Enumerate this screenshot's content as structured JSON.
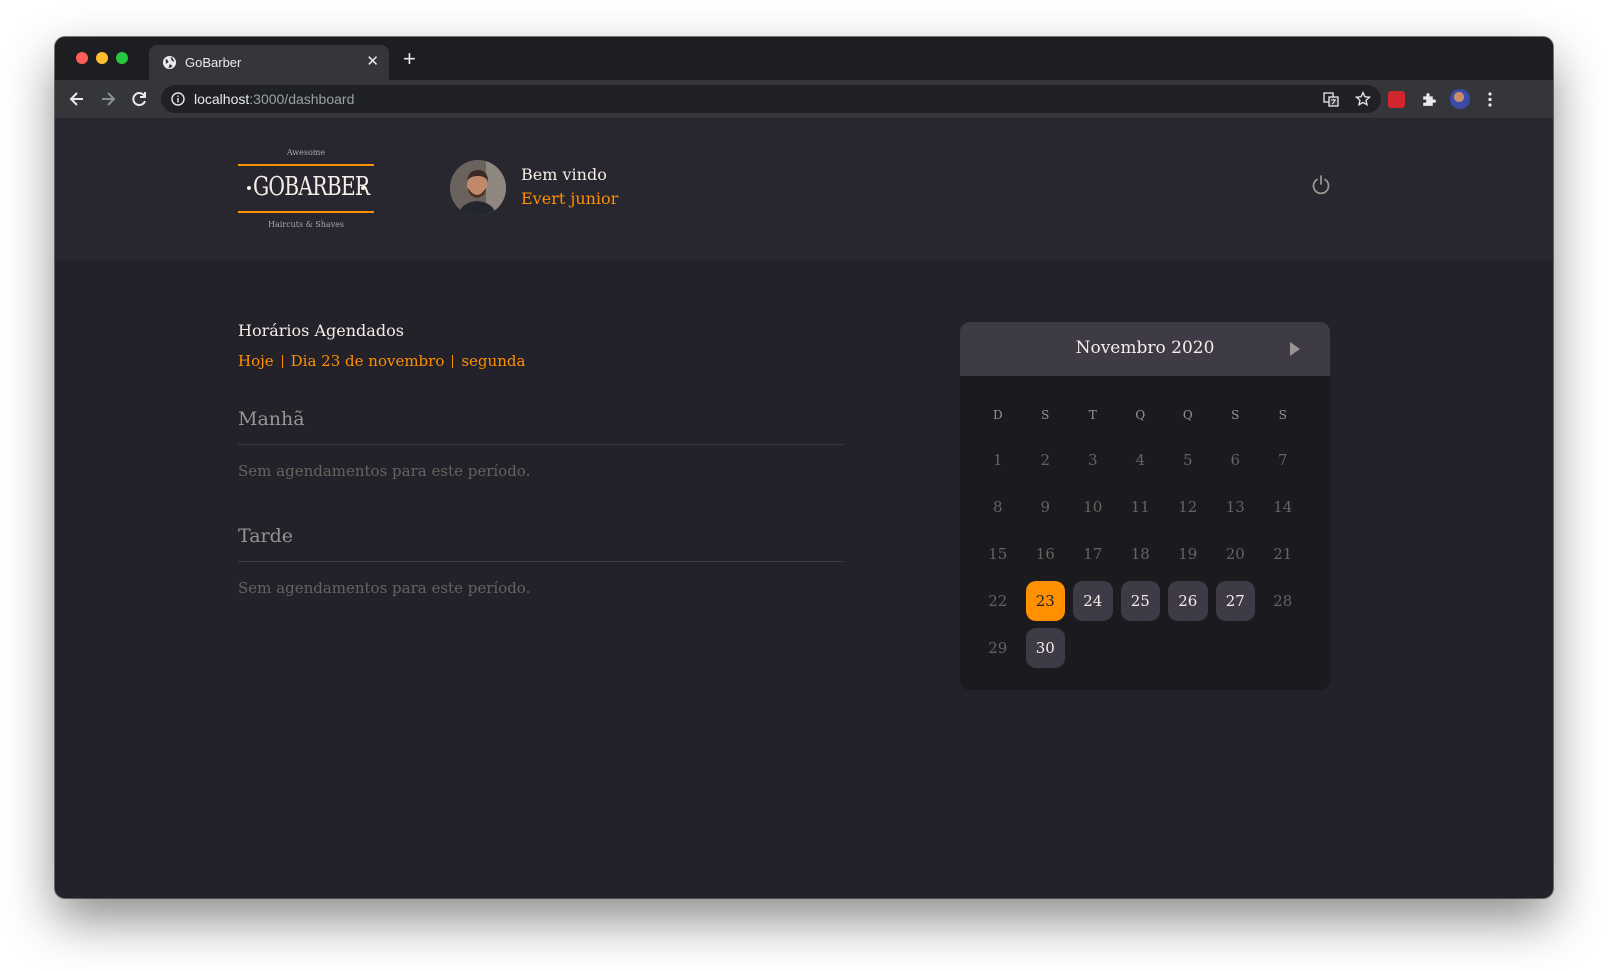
{
  "browser": {
    "tab_title": "GoBarber",
    "url_host": "localhost",
    "url_path": ":3000/dashboard"
  },
  "header": {
    "logo": {
      "top": "Awesome",
      "main": "GOBARBER",
      "bottom": "Haircuts & Shaves"
    },
    "welcome": "Bem vindo",
    "user_name": "Evert junior"
  },
  "schedule": {
    "title": "Horários Agendados",
    "today": "Hoje",
    "date": "Dia 23 de novembro",
    "weekday": "segunda",
    "periods": [
      {
        "title": "Manhã",
        "empty": "Sem agendamentos para este período."
      },
      {
        "title": "Tarde",
        "empty": "Sem agendamentos para este período."
      }
    ]
  },
  "calendar": {
    "month_label": "Novembro 2020",
    "weekdays": [
      "D",
      "S",
      "T",
      "Q",
      "Q",
      "S",
      "S"
    ],
    "selected_day": 23,
    "available_days": [
      24,
      25,
      26,
      27,
      30
    ],
    "days": [
      "1",
      "2",
      "3",
      "4",
      "5",
      "6",
      "7",
      "8",
      "9",
      "10",
      "11",
      "12",
      "13",
      "14",
      "15",
      "16",
      "17",
      "18",
      "19",
      "20",
      "21",
      "22",
      "23",
      "24",
      "25",
      "26",
      "27",
      "28",
      "29",
      "30"
    ]
  },
  "colors": {
    "accent": "#ff9000",
    "background": "#232129",
    "header": "#28262e",
    "surface": "#3e3b47"
  }
}
